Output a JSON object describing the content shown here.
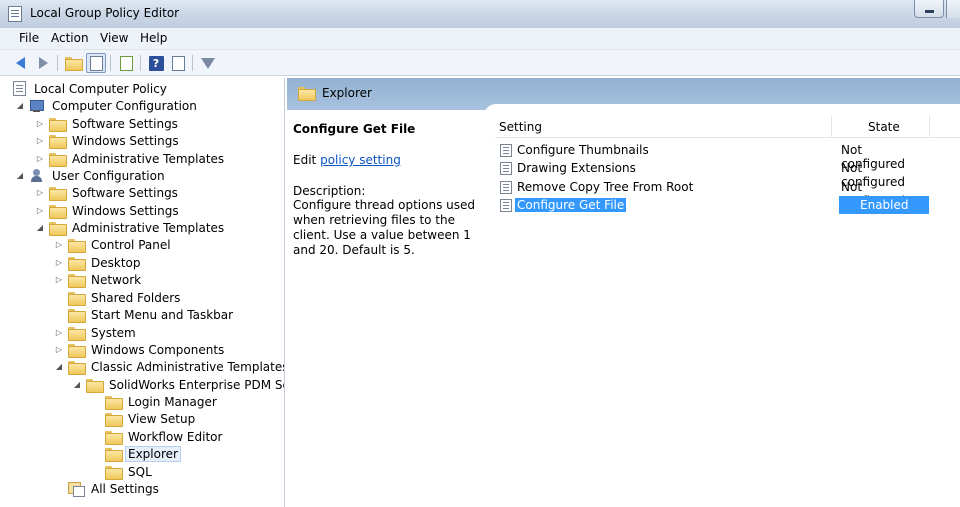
{
  "window": {
    "title": "Local Group Policy Editor"
  },
  "menu": [
    "File",
    "Action",
    "View",
    "Help"
  ],
  "toolbar": {
    "buttons": [
      "back-icon",
      "forward-icon",
      "up-folder-icon",
      "show-hide-tree-icon",
      "export-list-icon",
      "help-icon",
      "properties-icon",
      "filter-icon"
    ]
  },
  "tree": {
    "root": "Local Computer Policy",
    "computer_configuration": "Computer Configuration",
    "cc_software_settings": "Software Settings",
    "cc_windows_settings": "Windows Settings",
    "cc_admin_templates": "Administrative Templates",
    "user_configuration": "User Configuration",
    "uc_software_settings": "Software Settings",
    "uc_windows_settings": "Windows Settings",
    "uc_admin_templates": "Administrative Templates",
    "control_panel": "Control Panel",
    "desktop": "Desktop",
    "network": "Network",
    "shared_folders": "Shared Folders",
    "start_menu": "Start Menu and Taskbar",
    "system": "System",
    "windows_components": "Windows Components",
    "classic_admin": "Classic Administrative Templates (ADM)",
    "solidworks": "SolidWorks Enterprise PDM Settings",
    "login_manager": "Login Manager",
    "view_setup": "View Setup",
    "workflow_editor": "Workflow Editor",
    "explorer": "Explorer",
    "sql": "SQL",
    "all_settings": "All Settings"
  },
  "header": {
    "title": "Explorer"
  },
  "description": {
    "title": "Configure Get File",
    "edit_prefix": "Edit",
    "edit_link": "policy setting",
    "label": "Description:",
    "text": "Configure thread options used when retrieving files to the client. Use a value between 1 and 20. Default is 5."
  },
  "list": {
    "columns": {
      "setting": "Setting",
      "state": "State"
    },
    "rows": [
      {
        "name": "Configure Thumbnails",
        "state": "Not configured"
      },
      {
        "name": "Drawing Extensions",
        "state": "Not configured"
      },
      {
        "name": "Remove Copy Tree From Root",
        "state": "Not configured"
      },
      {
        "name": "Configure Get File",
        "state": "Enabled"
      }
    ]
  },
  "colors": {
    "selection": "#3399ff",
    "header_band": "#9db9d8",
    "link": "#0b55c4"
  }
}
